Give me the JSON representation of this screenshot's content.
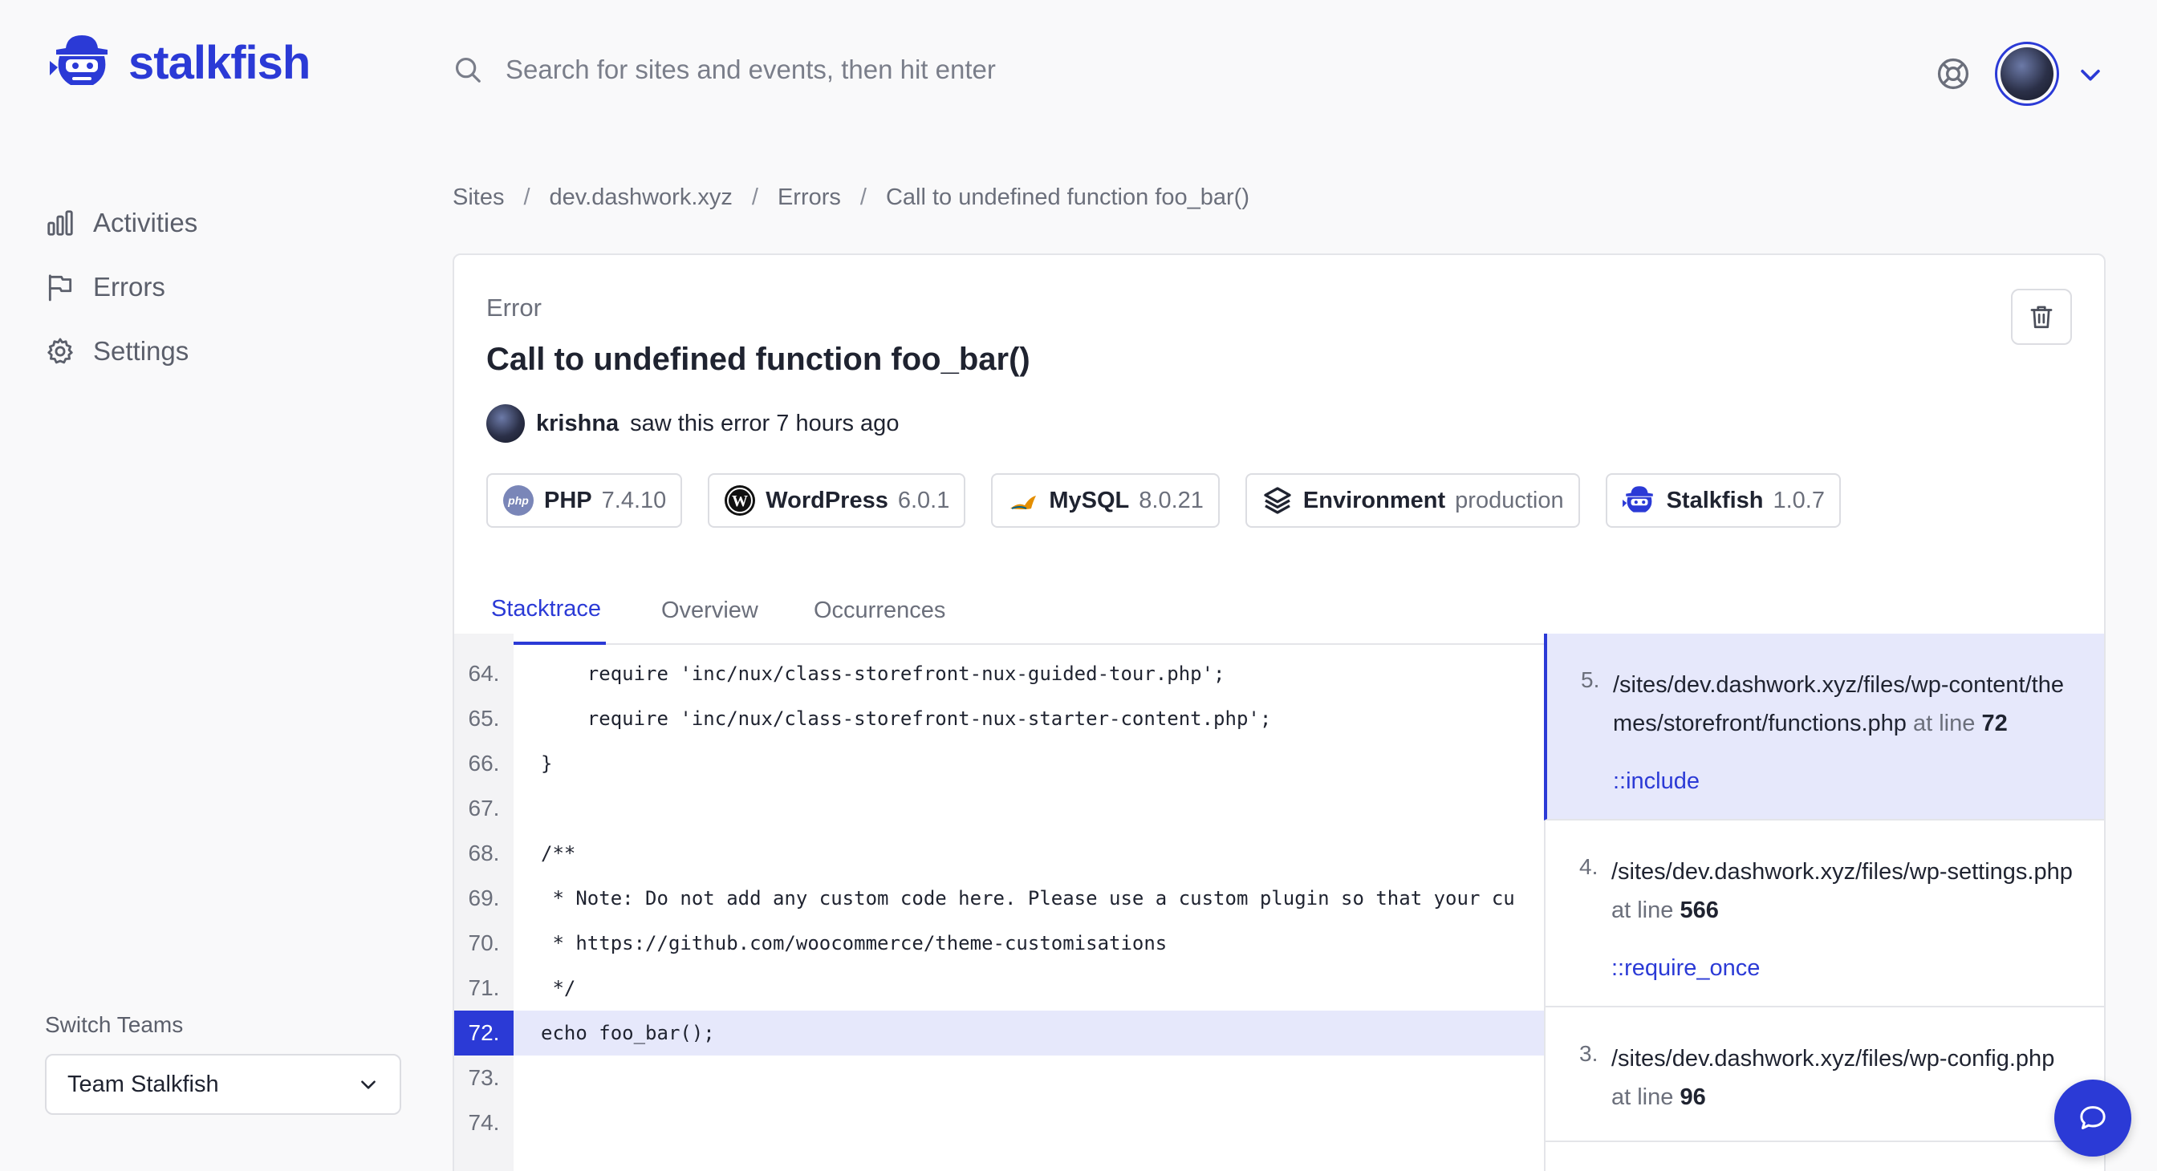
{
  "app": {
    "name": "stalkfish"
  },
  "sidebar": {
    "items": [
      {
        "label": "Activities",
        "icon": "bar-chart-icon"
      },
      {
        "label": "Errors",
        "icon": "flag-icon"
      },
      {
        "label": "Settings",
        "icon": "gear-icon"
      }
    ],
    "switch_label": "Switch Teams",
    "team": "Team Stalkfish"
  },
  "header": {
    "search_placeholder": "Search for sites and events, then hit enter"
  },
  "breadcrumb": [
    "Sites",
    "dev.dashwork.xyz",
    "Errors",
    "Call to undefined function foo_bar()"
  ],
  "error": {
    "kicker": "Error",
    "title": "Call to undefined function foo_bar()",
    "user": "krishna",
    "seen_text": "saw this error 7 hours ago"
  },
  "badges": [
    {
      "name": "PHP",
      "value": "7.4.10",
      "icon": "php-icon"
    },
    {
      "name": "WordPress",
      "value": "6.0.1",
      "icon": "wordpress-icon"
    },
    {
      "name": "MySQL",
      "value": "8.0.21",
      "icon": "mysql-icon"
    },
    {
      "name": "Environment",
      "value": "production",
      "icon": "layers-icon"
    },
    {
      "name": "Stalkfish",
      "value": "1.0.7",
      "icon": "stalkfish-icon"
    }
  ],
  "tabs": [
    "Stacktrace",
    "Overview",
    "Occurrences"
  ],
  "code": [
    {
      "ln": "64.",
      "text": "    require 'inc/nux/class-storefront-nux-guided-tour.php';"
    },
    {
      "ln": "65.",
      "text": "    require 'inc/nux/class-storefront-nux-starter-content.php';"
    },
    {
      "ln": "66.",
      "text": "}"
    },
    {
      "ln": "67.",
      "text": ""
    },
    {
      "ln": "68.",
      "text": "/**"
    },
    {
      "ln": "69.",
      "text": " * Note: Do not add any custom code here. Please use a custom plugin so that your cu"
    },
    {
      "ln": "70.",
      "text": " * https://github.com/woocommerce/theme-customisations"
    },
    {
      "ln": "71.",
      "text": " */"
    },
    {
      "ln": "72.",
      "text": "echo foo_bar();"
    },
    {
      "ln": "73.",
      "text": ""
    },
    {
      "ln": "74.",
      "text": ""
    }
  ],
  "frames": [
    {
      "num": "5.",
      "path": "/sites/dev.dashwork.xyz/files/wp-content/themes/storefront/functions.php",
      "at": "at line",
      "line": "72",
      "fn": "::include"
    },
    {
      "num": "4.",
      "path": "/sites/dev.dashwork.xyz/files/wp-settings.php",
      "at": "at line",
      "line": "566",
      "fn": "::require_once"
    },
    {
      "num": "3.",
      "path": "/sites/dev.dashwork.xyz/files/wp-config.php",
      "at": "at line",
      "line": "96",
      "fn": ""
    }
  ],
  "colors": {
    "accent": "#2b3ad6",
    "highlight": "#e6e8fb"
  }
}
